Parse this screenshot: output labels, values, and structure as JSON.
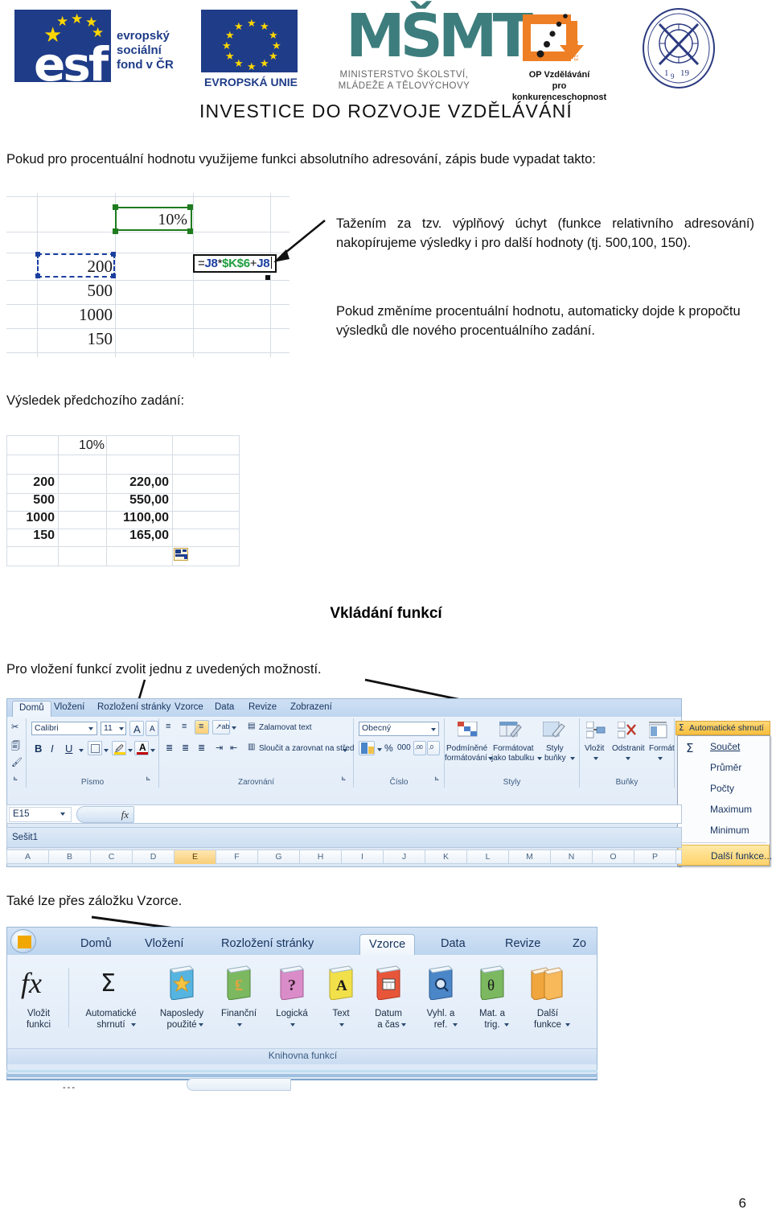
{
  "header": {
    "esf": {
      "acronym": "esf",
      "lines": [
        "evropský",
        "sociální",
        "fond v ČR"
      ]
    },
    "eu": {
      "caption": "EVROPSKÁ UNIE"
    },
    "msmt": {
      "mark": "MŠMT",
      "caption_line1": "MINISTERSTVO ŠKOLSTVÍ,",
      "caption_line2": "MLÁDEŽE A TĚLOVÝCHOVY"
    },
    "op": {
      "caption_line1": "OP Vzdělávání",
      "caption_line2": "pro konkurenceschopnost",
      "years": "2007-13"
    },
    "seal": {
      "year_left": "1",
      "year_mid": "9",
      "year_right": "19"
    },
    "banner": "INVESTICE DO ROZVOJE VZDĚLÁVÁNÍ"
  },
  "body": {
    "intro": "Pokud pro procentuální hodnotu využijeme funkci absolutního adresování, zápis bude vypadat takto:",
    "right_para_1": "Tažením za tzv. výplňový úchyt (funkce relativního adresování) nakopírujeme výsledky i pro další hodnoty (tj. 500,100, 150).",
    "right_para_2": "Pokud změníme procentuální hodnotu, automaticky dojde k propočtu výsledků dle nového procentuálního zadání.",
    "result_label": "Výsledek předchozího zadání:",
    "section_heading": "Vkládání funkcí",
    "insert_note": "Pro vložení funkcí zvolit jednu z uvedených možností.",
    "tab_note": "Také lze přes záložku Vzorce.",
    "page_number": "6"
  },
  "sheet1": {
    "percent": "10%",
    "values": [
      "200",
      "500",
      "1000",
      "150"
    ],
    "formula": {
      "full": "=J8*$K$6+J8",
      "parts": [
        {
          "text": "=",
          "color": "black"
        },
        {
          "text": "J8",
          "color": "blue"
        },
        {
          "text": "*",
          "color": "black"
        },
        {
          "text": "$K$6",
          "color": "green"
        },
        {
          "text": "+",
          "color": "black"
        },
        {
          "text": "J8",
          "color": "blue"
        }
      ]
    }
  },
  "sheet2": {
    "percent": "10%",
    "rows": [
      {
        "input": "200",
        "result": "220,00"
      },
      {
        "input": "500",
        "result": "550,00"
      },
      {
        "input": "1000",
        "result": "1100,00"
      },
      {
        "input": "150",
        "result": "165,00"
      }
    ],
    "fill_options_icon": "fill-options-icon"
  },
  "ribbon_home": {
    "tabs": [
      "Domů",
      "Vložení",
      "Rozložení stránky",
      "Vzorce",
      "Data",
      "Revize",
      "Zobrazení"
    ],
    "active_tab": "Domů",
    "clipboard": {
      "icons": [
        "cut-scissors-icon",
        "copy-icon",
        "format-painter-icon"
      ]
    },
    "font": {
      "group_label": "Písmo",
      "font_name": "Calibri",
      "font_size": "11",
      "grow_label": "A",
      "shrink_label": "A",
      "bold": "B",
      "italic": "I",
      "underline": "U"
    },
    "alignment": {
      "group_label": "Zarovnání",
      "wrap_text": "Zalamovat text",
      "merge_center": "Sloučit a zarovnat na střed"
    },
    "number": {
      "group_label": "Číslo",
      "format": "Obecný",
      "percent": "%",
      "thousands": "000",
      "inc_dec": ",00",
      "dec_dec": ",0"
    },
    "styles": {
      "group_label": "Styly",
      "buttons": [
        {
          "l1": "Podmíněné",
          "l2": "formátování"
        },
        {
          "l1": "Formátovat",
          "l2": "jako tabulku"
        },
        {
          "l1": "Styly",
          "l2": "buňky"
        }
      ]
    },
    "cells": {
      "group_label": "Buňky",
      "buttons": [
        "Vložit",
        "Odstranit",
        "Formát"
      ]
    },
    "autosum": {
      "button_label": "Automatické shrnutí",
      "sigma": "Σ",
      "menu": [
        "Součet",
        "Průměr",
        "Počty",
        "Maximum",
        "Minimum"
      ],
      "menu_highlight": "Další funkce..."
    },
    "formula_bar": {
      "name_box": "E15",
      "fx_label": "fx",
      "value": ""
    },
    "workbook_title": "Sešit1",
    "column_headers": [
      "A",
      "B",
      "C",
      "D",
      "E",
      "F",
      "G",
      "H",
      "I",
      "J",
      "K",
      "L",
      "M",
      "N",
      "O",
      "P"
    ],
    "selected_column": "E"
  },
  "ribbon_formulas": {
    "tabs": [
      "Domů",
      "Vložení",
      "Rozložení stránky",
      "Vzorce",
      "Data",
      "Revize",
      "Zo"
    ],
    "active_tab": "Vzorce",
    "group_label": "Knihovna funkcí",
    "buttons": [
      {
        "l1": "Vložit",
        "l2": "funkci",
        "icon": "fx-icon",
        "color": "#1b1b1b",
        "dropdown": false
      },
      {
        "l1": "Automatické",
        "l2": "shrnutí",
        "icon": "sigma-icon",
        "color": "#1b1b1b",
        "dropdown": true
      },
      {
        "l1": "Naposledy",
        "l2": "použité",
        "icon": "book-icon",
        "color": "#56b4e0",
        "dropdown": true
      },
      {
        "l1": "Finanční",
        "l2": "",
        "icon": "book-icon",
        "color": "#7cb860",
        "dropdown": true
      },
      {
        "l1": "Logická",
        "l2": "",
        "icon": "book-icon",
        "color": "#d98cc8",
        "dropdown": true
      },
      {
        "l1": "Text",
        "l2": "",
        "icon": "book-icon",
        "color": "#f2e04a",
        "dropdown": true
      },
      {
        "l1": "Datum",
        "l2": "a čas",
        "icon": "book-icon",
        "color": "#e8563a",
        "dropdown": true
      },
      {
        "l1": "Vyhl. a",
        "l2": "ref.",
        "icon": "book-icon",
        "color": "#4a86c8",
        "dropdown": true
      },
      {
        "l1": "Mat. a",
        "l2": "trig.",
        "icon": "book-icon",
        "color": "#7cb860",
        "dropdown": true
      },
      {
        "l1": "Další",
        "l2": "funkce",
        "icon": "book-stack-icon",
        "color": "#f0a63c",
        "dropdown": true
      }
    ],
    "glyphs": [
      "fx",
      "Σ",
      "★",
      "₤",
      "?",
      "A",
      "▦",
      "🔍",
      "θ",
      ""
    ]
  },
  "colors": {
    "accent_blue": "#1f3c88",
    "excel_green": "#1e7b1e",
    "formula_blue": "#1b3fa0",
    "formula_green": "#1e9e3e",
    "ribbon_blue": "#bdd5ef",
    "highlight_orange": "#f8cf78"
  }
}
